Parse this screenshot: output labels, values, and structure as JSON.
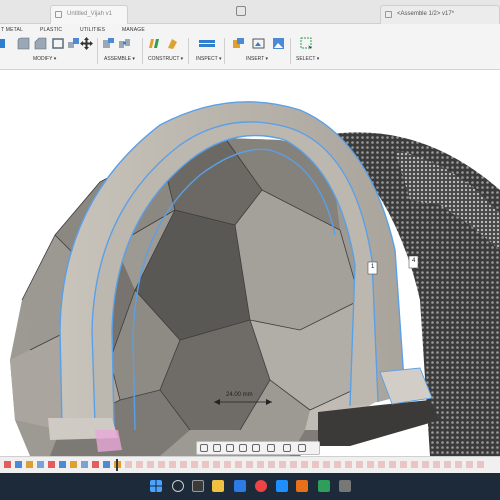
{
  "tabs": [
    {
      "label": "Untitled_Vijah v1",
      "active": false
    },
    {
      "label": "<Assemble 1/2> v17*",
      "active": true
    }
  ],
  "toolbar": {
    "categories": [
      "T METAL",
      "PLASTIC",
      "UTILITIES",
      "MANAGE"
    ],
    "groups": [
      "MODIFY ▾",
      "ASSEMBLE ▾",
      "CONSTRUCT ▾",
      "INSPECT ▾",
      "INSERT ▾",
      "SELECT ▾"
    ]
  },
  "viewport": {
    "dimension_label": "24.00 mm",
    "small_dim_label": "1",
    "small_dim_label_2": "4"
  },
  "colors": {
    "accent": "#1f6fd6",
    "selection_edge": "#5aa0e8",
    "model_dark": "#3d3d3d",
    "taskbar": "#1c2a3a"
  }
}
